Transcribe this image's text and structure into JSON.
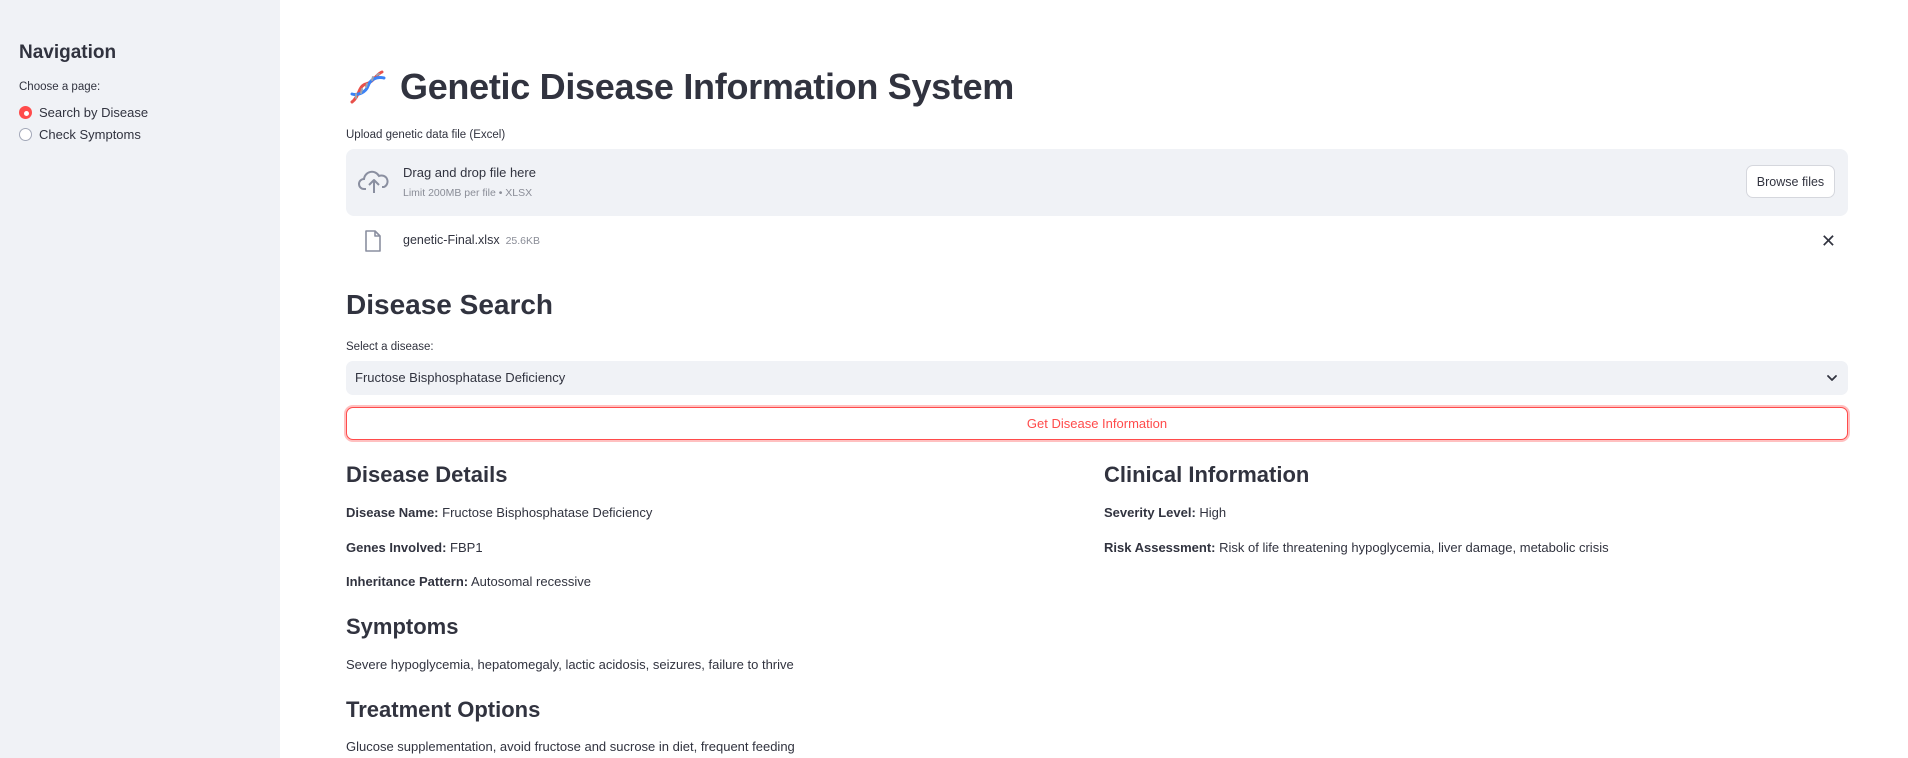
{
  "sidebar": {
    "title": "Navigation",
    "radio_label": "Choose a page:",
    "options": [
      {
        "label": "Search by Disease",
        "checked": true
      },
      {
        "label": "Check Symptoms",
        "checked": false
      }
    ]
  },
  "header": {
    "icon": "dna-icon",
    "title": "Genetic Disease Information System"
  },
  "uploader": {
    "label": "Upload genetic data file (Excel)",
    "drop_text": "Drag and drop file here",
    "limit_text": "Limit 200MB per file • XLSX",
    "browse_label": "Browse files",
    "file": {
      "name": "genetic-Final.xlsx",
      "size": "25.6KB"
    }
  },
  "search": {
    "heading": "Disease Search",
    "select_label": "Select a disease:",
    "selected_value": "Fructose Bisphosphatase Deficiency",
    "button_label": "Get Disease Information"
  },
  "details": {
    "heading": "Disease Details",
    "name_label": "Disease Name:",
    "name_value": "Fructose Bisphosphatase Deficiency",
    "genes_label": "Genes Involved:",
    "genes_value": "FBP1",
    "inheritance_label": "Inheritance Pattern:",
    "inheritance_value": "Autosomal recessive"
  },
  "clinical": {
    "heading": "Clinical Information",
    "severity_label": "Severity Level:",
    "severity_value": "High",
    "risk_label": "Risk Assessment:",
    "risk_value": "Risk of life threatening hypoglycemia, liver damage, metabolic crisis"
  },
  "symptoms": {
    "heading": "Symptoms",
    "text": "Severe hypoglycemia, hepatomegaly, lactic acidosis, seizures, failure to thrive"
  },
  "treatment": {
    "heading": "Treatment Options",
    "text": "Glucose supplementation, avoid fructose and sucrose in diet, frequent feeding"
  },
  "colors": {
    "accent": "#ff4b4b",
    "sidebar_bg": "#f0f2f6",
    "text": "#31333f"
  }
}
